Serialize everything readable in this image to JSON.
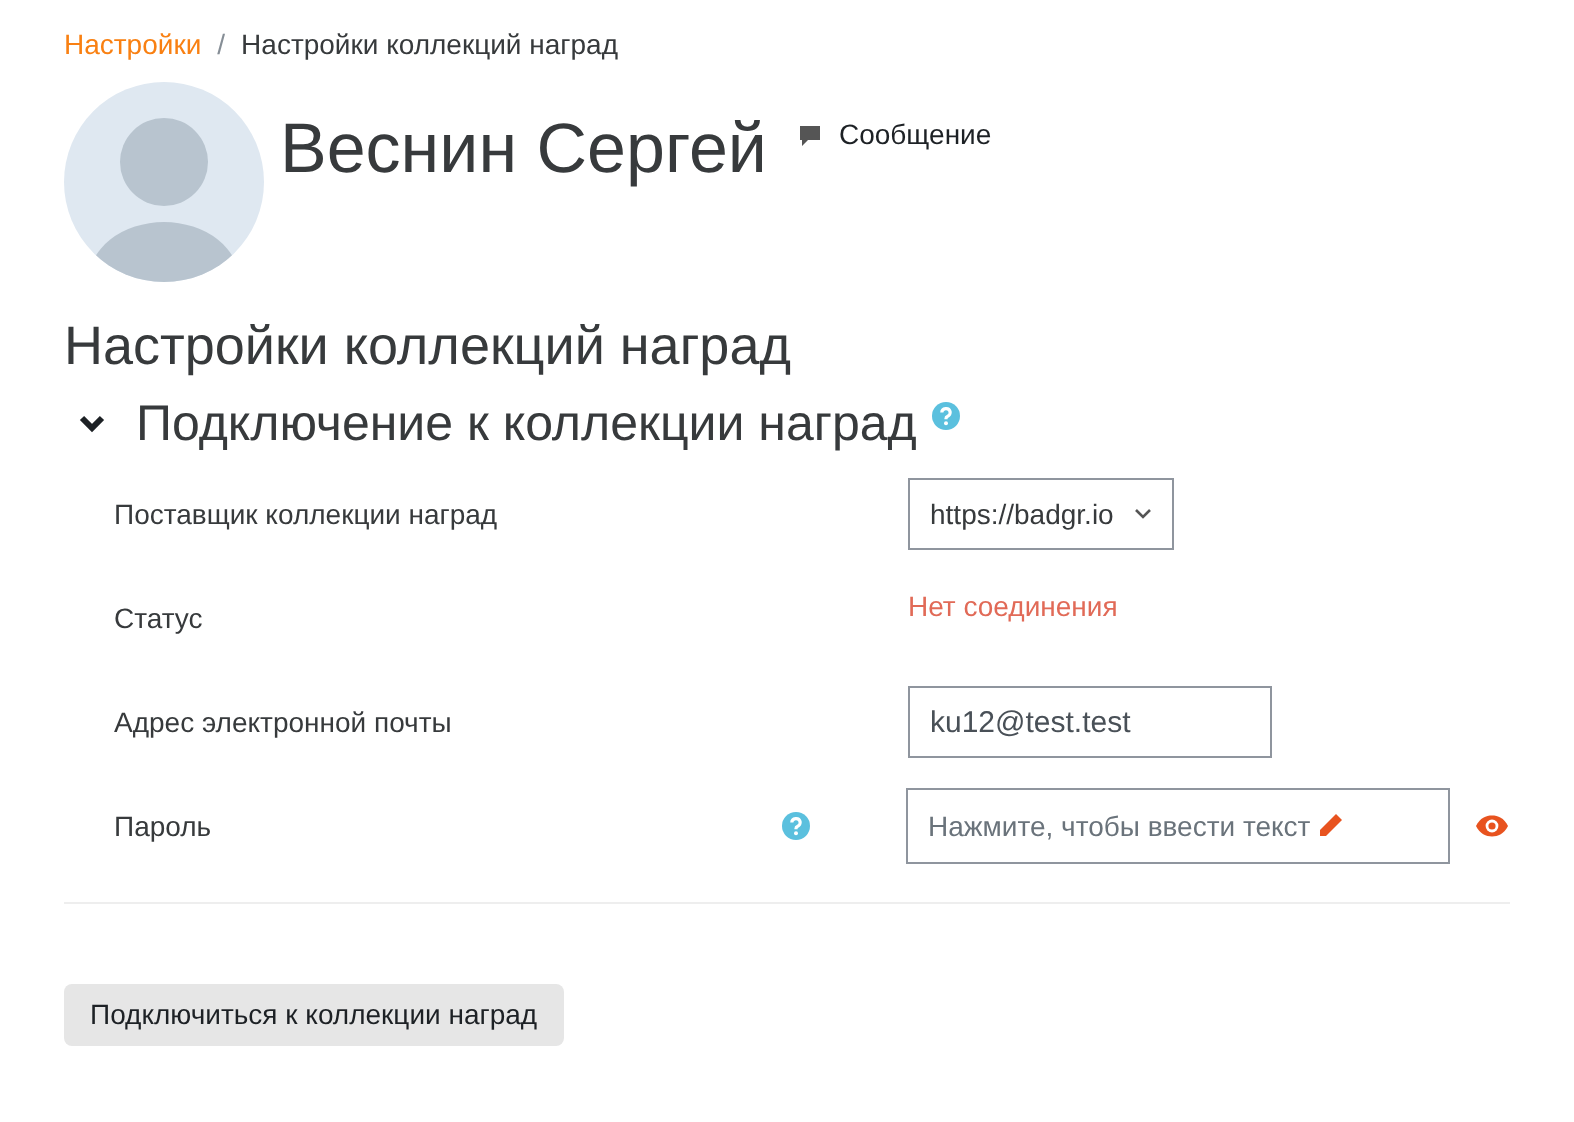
{
  "breadcrumb": [
    {
      "label": "Настройки",
      "link": true
    },
    {
      "label": "Настройки коллекций наград",
      "link": false
    }
  ],
  "breadcrumb_separator": "/",
  "profile": {
    "name": "Веснин Сергей",
    "message_link": "Сообщение"
  },
  "page_title": "Настройки коллекций наград",
  "section": {
    "title": "Подключение к коллекции наград",
    "expanded": true
  },
  "fields": [
    {
      "kind": "select",
      "label": "Поставщик коллекции наград",
      "value": "https://badgr.io",
      "help": false
    },
    {
      "kind": "status",
      "label": "Статус",
      "value": "Нет соединения",
      "help": false
    },
    {
      "kind": "input",
      "label": "Адрес электронной почты",
      "value": "ku12@test.test",
      "help": false
    },
    {
      "kind": "password",
      "label": "Пароль",
      "placeholder": "Нажмите, чтобы ввести текст",
      "help": true
    }
  ],
  "button": "Подключиться к коллекции наград"
}
